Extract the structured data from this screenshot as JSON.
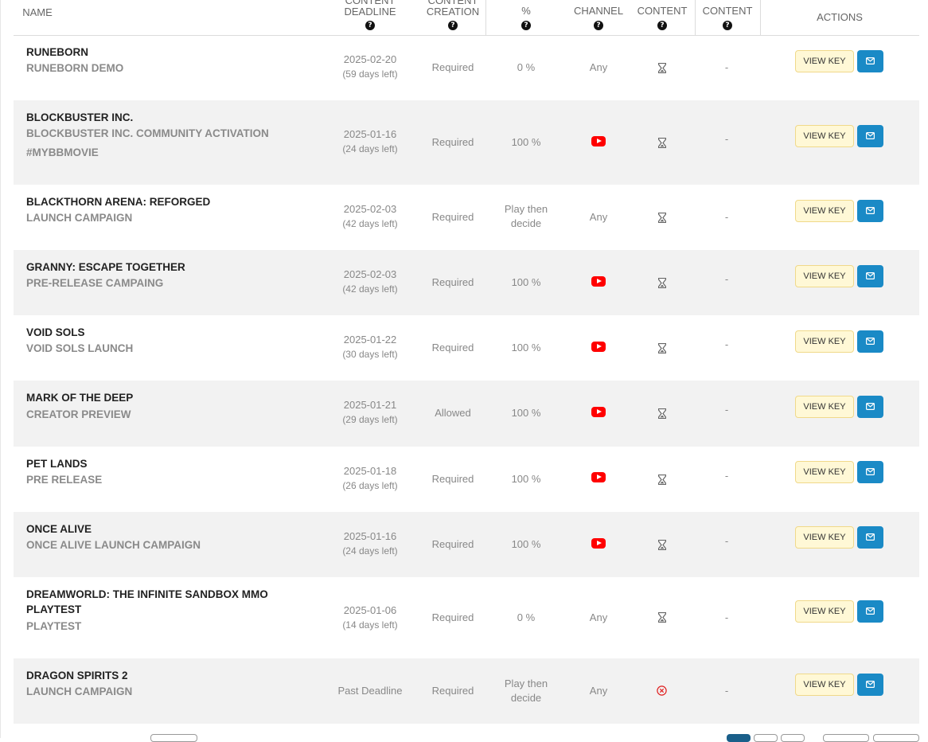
{
  "header": {
    "name": "NAME",
    "deadline": "CONTENT DEADLINE",
    "creation": "CONTENT CREATION",
    "percent": "%",
    "channel": "CHANNEL",
    "content1": "CONTENT",
    "content2": "CONTENT",
    "actions": "ACTIONS",
    "help_glyph": "?"
  },
  "buttons": {
    "view_key": "VIEW KEY"
  },
  "rows": [
    {
      "title": "RUNEBORN",
      "subtitle": "RUNEBORN DEMO",
      "date": "2025-02-20",
      "days": "(59 days left)",
      "creation": "Required",
      "percent": "0 %",
      "channel": "Any",
      "content_icon": "hourglass-icon",
      "content2": "-"
    },
    {
      "title": "BLOCKBUSTER INC.",
      "subtitle": "BLOCKBUSTER INC. COMMUNITY ACTIVATION #MYBBMOVIE",
      "date": "2025-01-16",
      "days": "(24 days left)",
      "creation": "Required",
      "percent": "100 %",
      "channel": "youtube-icon",
      "content_icon": "hourglass-icon",
      "content2": "-"
    },
    {
      "title": "BLACKTHORN ARENA: REFORGED",
      "subtitle": "LAUNCH CAMPAIGN",
      "date": "2025-02-03",
      "days": "(42 days left)",
      "creation": "Required",
      "percent": "Play then decide",
      "channel": "Any",
      "content_icon": "hourglass-icon",
      "content2": "-"
    },
    {
      "title": "GRANNY: ESCAPE TOGETHER",
      "subtitle": "PRE-RELEASE CAMPAING",
      "date": "2025-02-03",
      "days": "(42 days left)",
      "creation": "Required",
      "percent": "100 %",
      "channel": "youtube-icon",
      "content_icon": "hourglass-icon",
      "content2": "-"
    },
    {
      "title": "VOID SOLS",
      "subtitle": "VOID SOLS LAUNCH",
      "date": "2025-01-22",
      "days": "(30 days left)",
      "creation": "Required",
      "percent": "100 %",
      "channel": "youtube-icon",
      "content_icon": "hourglass-icon",
      "content2": "-"
    },
    {
      "title": "MARK OF THE DEEP",
      "subtitle": "CREATOR PREVIEW",
      "date": "2025-01-21",
      "days": "(29 days left)",
      "creation": "Allowed",
      "percent": "100 %",
      "channel": "youtube-icon",
      "content_icon": "hourglass-icon",
      "content2": "-"
    },
    {
      "title": "PET LANDS",
      "subtitle": "PRE RELEASE",
      "date": "2025-01-18",
      "days": "(26 days left)",
      "creation": "Required",
      "percent": "100 %",
      "channel": "youtube-icon",
      "content_icon": "hourglass-icon",
      "content2": "-"
    },
    {
      "title": "ONCE ALIVE",
      "subtitle": "ONCE ALIVE LAUNCH CAMPAIGN",
      "date": "2025-01-16",
      "days": "(24 days left)",
      "creation": "Required",
      "percent": "100 %",
      "channel": "youtube-icon",
      "content_icon": "hourglass-icon",
      "content2": "-"
    },
    {
      "title": "DREAMWORLD: THE INFINITE SANDBOX MMO PLAYTEST",
      "subtitle": "PLAYTEST",
      "date": "2025-01-06",
      "days": "(14 days left)",
      "creation": "Required",
      "percent": "0 %",
      "channel": "Any",
      "content_icon": "hourglass-icon",
      "content2": "-"
    },
    {
      "title": "DRAGON SPIRITS 2",
      "subtitle": "LAUNCH CAMPAIGN",
      "date": "Past Deadline",
      "days": "",
      "creation": "Required",
      "percent": "Play then decide",
      "channel": "Any",
      "content_icon": "x-circle-icon",
      "content2": "-"
    }
  ],
  "colors": {
    "youtube": "#ff0000",
    "mail_button": "#1a8ac6",
    "view_key_bg": "#fff8d6",
    "row_alt": "#f2f2f2",
    "error": "#e02020"
  }
}
